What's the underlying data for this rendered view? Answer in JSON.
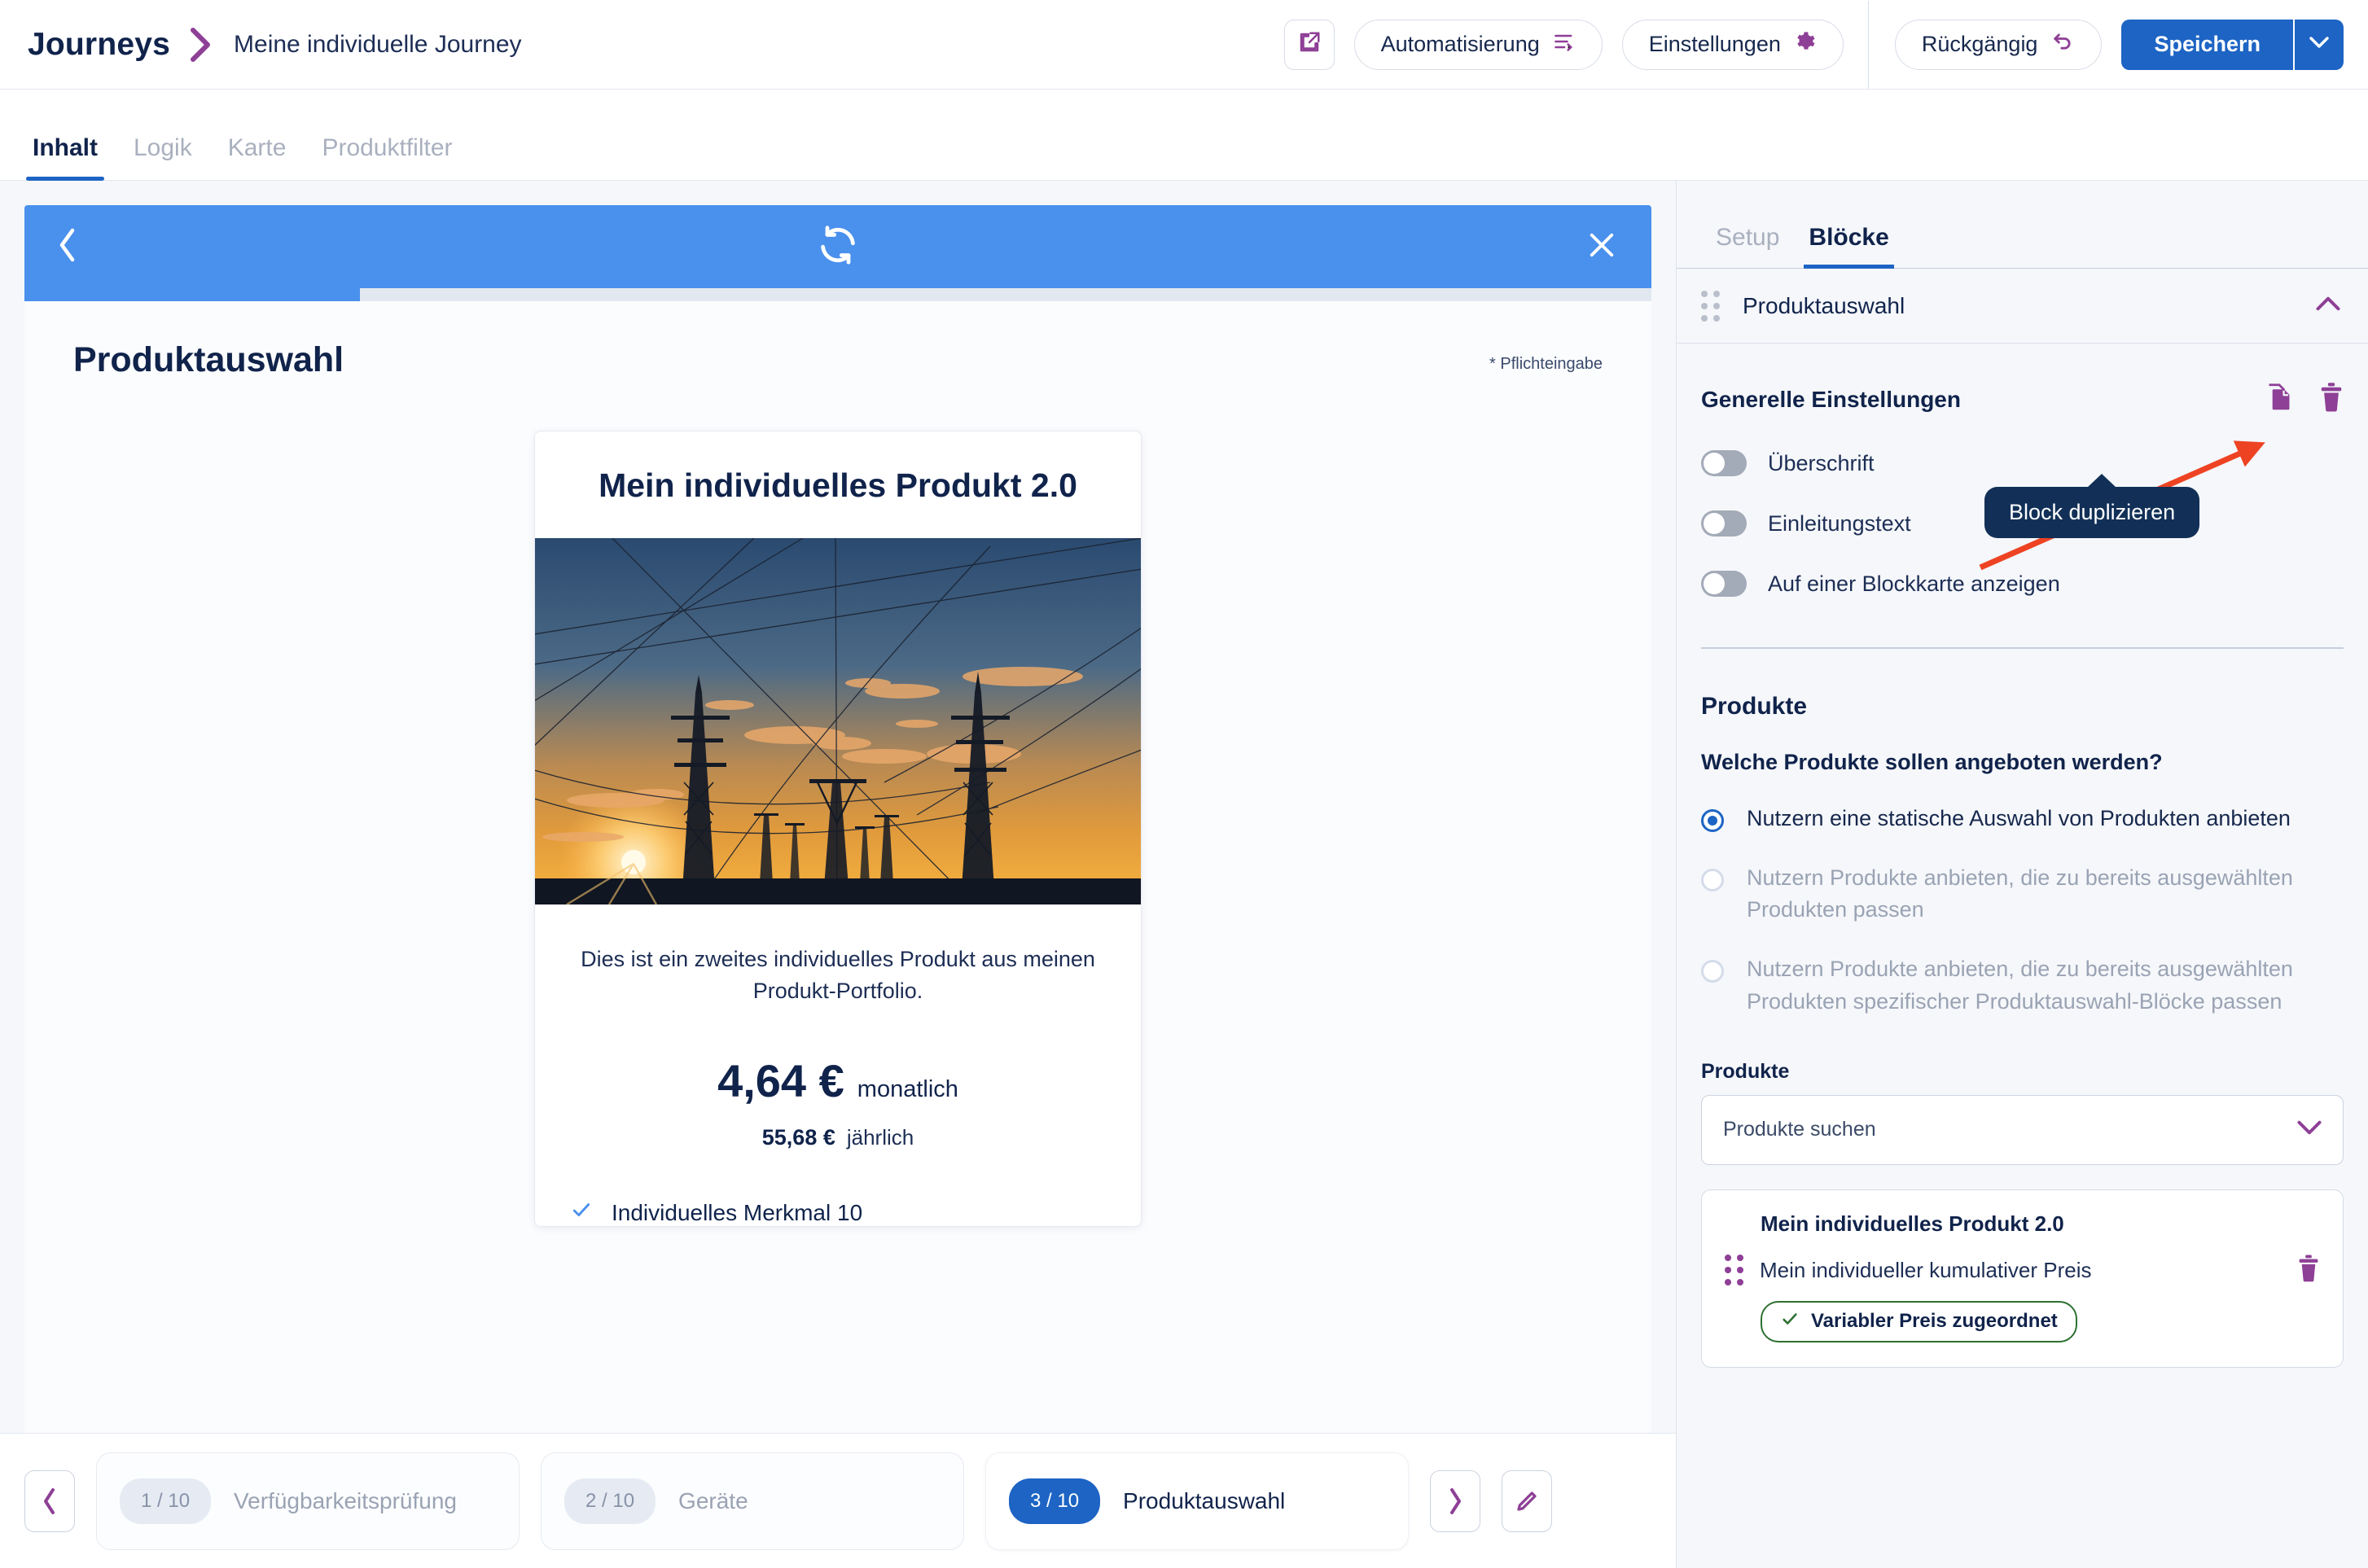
{
  "header": {
    "brand": "Journeys",
    "breadcrumb_title": "Meine individuelle Journey",
    "external_link_icon": "external-link-icon",
    "automation_label": "Automatisierung",
    "settings_label": "Einstellungen",
    "undo_label": "Rückgängig",
    "save_label": "Speichern",
    "save_dropdown_icon": "chevron-down-icon",
    "accent_purple": "#8e3f96",
    "accent_blue": "#1d64c4",
    "text_navy": "#10234b"
  },
  "tabs": [
    {
      "label": "Inhalt",
      "active": true
    },
    {
      "label": "Logik",
      "active": false
    },
    {
      "label": "Karte",
      "active": false
    },
    {
      "label": "Produktfilter",
      "active": false
    }
  ],
  "preview": {
    "header_back_icon": "chevron-left-icon",
    "header_refresh_icon": "refresh-icon",
    "header_close_icon": "close-icon",
    "header_color": "#4a90ed",
    "progress_percent": 20.6,
    "page_title": "Produktauswahl",
    "required_note": "* Pflichteingabe",
    "product_card": {
      "title": "Mein individuelles Produkt 2.0",
      "image_alt": "sunset-power-lines-image",
      "description": "Dies ist ein zweites individuelles Produkt aus meinen Produkt-Portfolio.",
      "price_monthly": "4,64 €",
      "price_monthly_period": "monatlich",
      "price_yearly": "55,68 €",
      "price_yearly_period": "jährlich",
      "feature": "Individuelles Merkmal 10",
      "feature_icon": "check-icon"
    }
  },
  "stepper": {
    "prev_icon": "chevron-left-icon",
    "next_icon": "chevron-right-icon",
    "edit_icon": "pencil-icon",
    "steps": [
      {
        "badge": "1 / 10",
        "label": "Verfügbarkeitsprüfung",
        "active": false
      },
      {
        "badge": "2 / 10",
        "label": "Geräte",
        "active": false
      },
      {
        "badge": "3 / 10",
        "label": "Produktauswahl",
        "active": true
      }
    ]
  },
  "sidebar": {
    "tabs": [
      {
        "label": "Setup",
        "active": false
      },
      {
        "label": "Blöcke",
        "active": true
      }
    ],
    "block": {
      "title": "Produktauswahl",
      "drag_handle_icon": "drag-handle-icon",
      "collapse_icon": "chevron-up-icon"
    },
    "general": {
      "heading": "Generelle Einstellungen",
      "duplicate_icon": "duplicate-icon",
      "delete_icon": "trash-icon",
      "toggles": [
        {
          "label": "Überschrift",
          "on": false
        },
        {
          "label": "Einleitungstext",
          "on": false
        },
        {
          "label": "Auf einer Blockkarte anzeigen",
          "on": false
        }
      ]
    },
    "products": {
      "heading": "Produkte",
      "question": "Welche Produkte sollen angeboten werden?",
      "options": [
        {
          "label": "Nutzern eine statische Auswahl von Produkten anbieten",
          "selected": true,
          "disabled": false
        },
        {
          "label": "Nutzern Produkte anbieten, die zu bereits ausgewählten Produkten passen",
          "selected": false,
          "disabled": true
        },
        {
          "label": "Nutzern Produkte anbieten, die zu bereits ausgewählten Produkten spezifischer Produktauswahl-Blöcke passen",
          "selected": false,
          "disabled": true
        }
      ],
      "field_label": "Produkte",
      "search_placeholder": "Produkte suchen",
      "search_chevron_icon": "chevron-down-icon",
      "selected_product": {
        "title": "Mein individuelles Produkt 2.0",
        "price_name": "Mein individueller kumulativer Preis",
        "drag_handle_icon": "drag-handle-icon",
        "delete_icon": "trash-icon",
        "badge_label": "Variabler Preis zugeordnet",
        "badge_icon": "check-icon",
        "badge_color": "#2e7031"
      }
    }
  },
  "annotation": {
    "tooltip_text": "Block duplizieren",
    "arrow_color": "#ee4323",
    "tooltip_bg": "#123057"
  }
}
